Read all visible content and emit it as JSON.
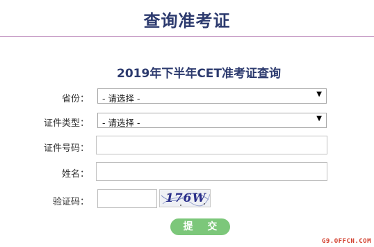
{
  "page": {
    "title": "查询准考证"
  },
  "form": {
    "heading": "2019年下半年CET准考证查询",
    "province": {
      "label": "省份：",
      "selected": "- 请选择 -"
    },
    "id_type": {
      "label": "证件类型：",
      "selected": "- 请选择 -"
    },
    "id_number": {
      "label": "证件号码：",
      "value": ""
    },
    "name": {
      "label": "姓名：",
      "value": ""
    },
    "captcha": {
      "label": "验证码：",
      "value": "",
      "image_text": "176W"
    },
    "submit_label": "提 交"
  },
  "watermark": "G9.OFFCN.COM",
  "colors": {
    "title": "#2c3a6e",
    "divider": "#c9a0c8",
    "submit": "#7cc77a",
    "watermark": "#d23c2a"
  },
  "icons": {
    "select_arrow": "triangle-down-icon",
    "captcha": "captcha-image"
  }
}
